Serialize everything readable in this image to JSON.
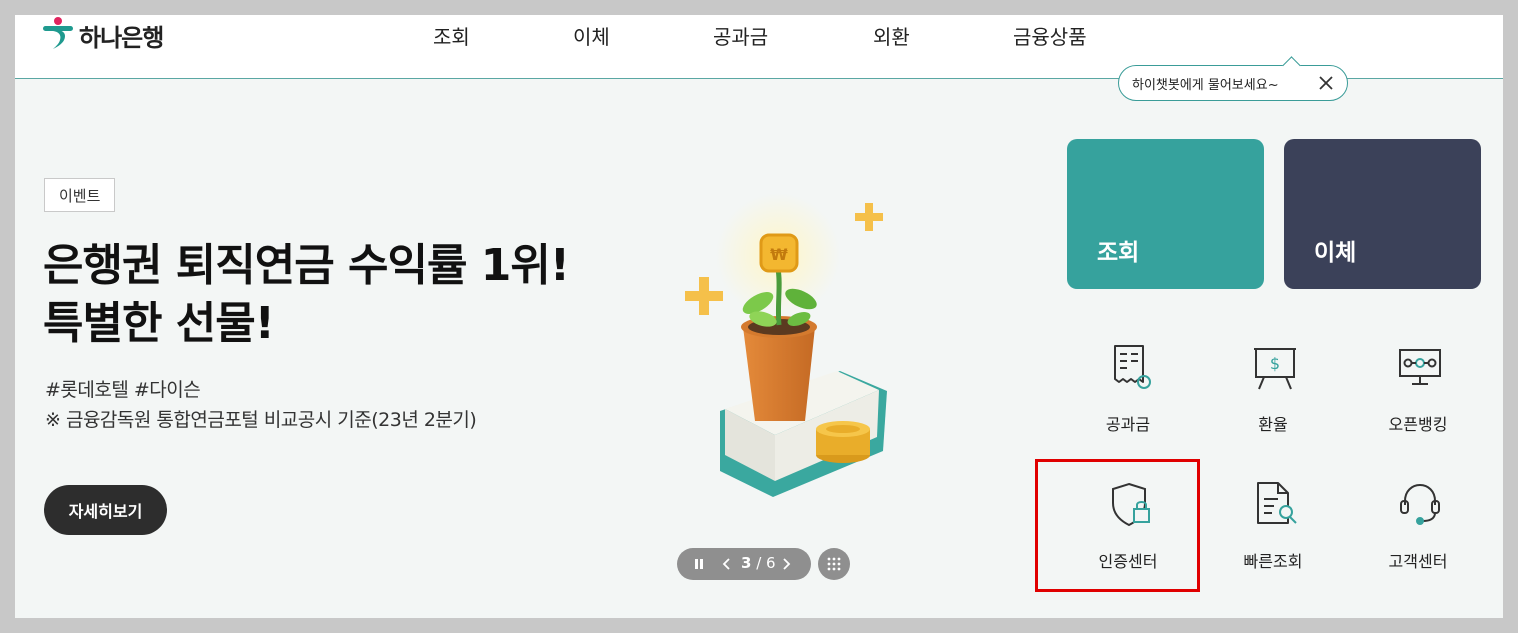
{
  "brand": {
    "logo_text": "하나은행"
  },
  "header": {
    "nav": [
      "조회",
      "이체",
      "공과금",
      "외환",
      "금융상품"
    ],
    "icons": [
      "chatbot-icon",
      "user-icon",
      "search-icon",
      "apps-grid-icon"
    ]
  },
  "chatbot_tip": {
    "text": "하이챗봇에게 물어보세요~"
  },
  "hero": {
    "badge": "이벤트",
    "title_line1": "은행권 퇴직연금 수익률 1위!",
    "title_line2": "특별한 선물!",
    "tags": "#롯데호텔 #다이슨",
    "note": "※ 금융감독원 통합연금포털 비교공시 기준(23년 2분기)",
    "cta": "자세히보기"
  },
  "slider": {
    "current": "3",
    "separator": " / ",
    "total": "6"
  },
  "tiles": {
    "inquiry": "조회",
    "transfer": "이체"
  },
  "quick_menu": [
    {
      "label": "공과금",
      "icon": "bill-receipt-icon"
    },
    {
      "label": "환율",
      "icon": "exchange-rate-board-icon"
    },
    {
      "label": "오픈뱅킹",
      "icon": "open-banking-icon"
    },
    {
      "label": "인증센터",
      "icon": "shield-lock-icon"
    },
    {
      "label": "빠른조회",
      "icon": "document-search-icon"
    },
    {
      "label": "고객센터",
      "icon": "headset-icon"
    }
  ],
  "colors": {
    "brand_teal": "#36a29d",
    "navy": "#3b4159",
    "highlight_red": "#e00000",
    "dark_button": "#2d2d2d"
  }
}
